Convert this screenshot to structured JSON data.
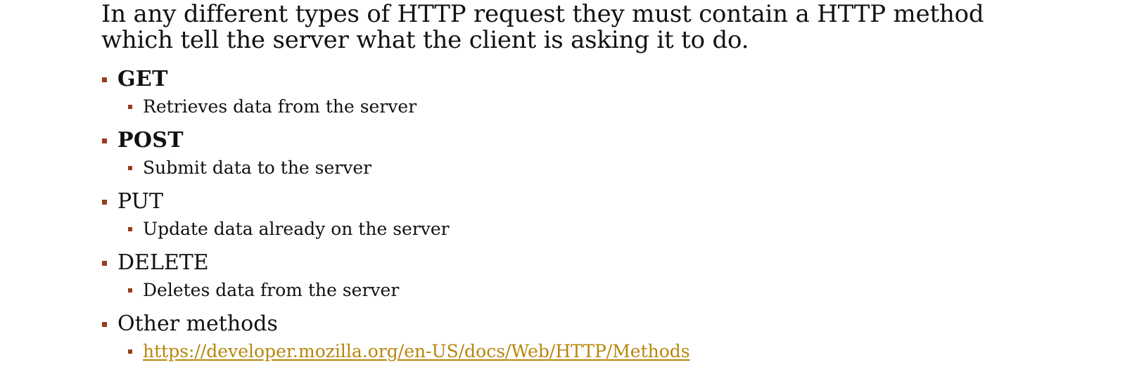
{
  "intro": {
    "line1": "In any different types of HTTP request they must contain a HTTP method",
    "line2": "which tell the server what the client is asking it to do."
  },
  "methods": [
    {
      "name": "GET",
      "description": "Retrieves data from the server"
    },
    {
      "name": "POST",
      "description": "Submit data to the server"
    },
    {
      "name": "PUT",
      "description": "Update data already on the server"
    },
    {
      "name": "DELETE",
      "description": "Deletes data from the server"
    },
    {
      "name": "Other methods",
      "description": "https://developer.mozilla.org/en-US/docs/Web/HTTP/Methods"
    }
  ],
  "colors": {
    "bullet_marker": "#9a3b1c",
    "link": "#b8860b",
    "text": "#111111"
  }
}
